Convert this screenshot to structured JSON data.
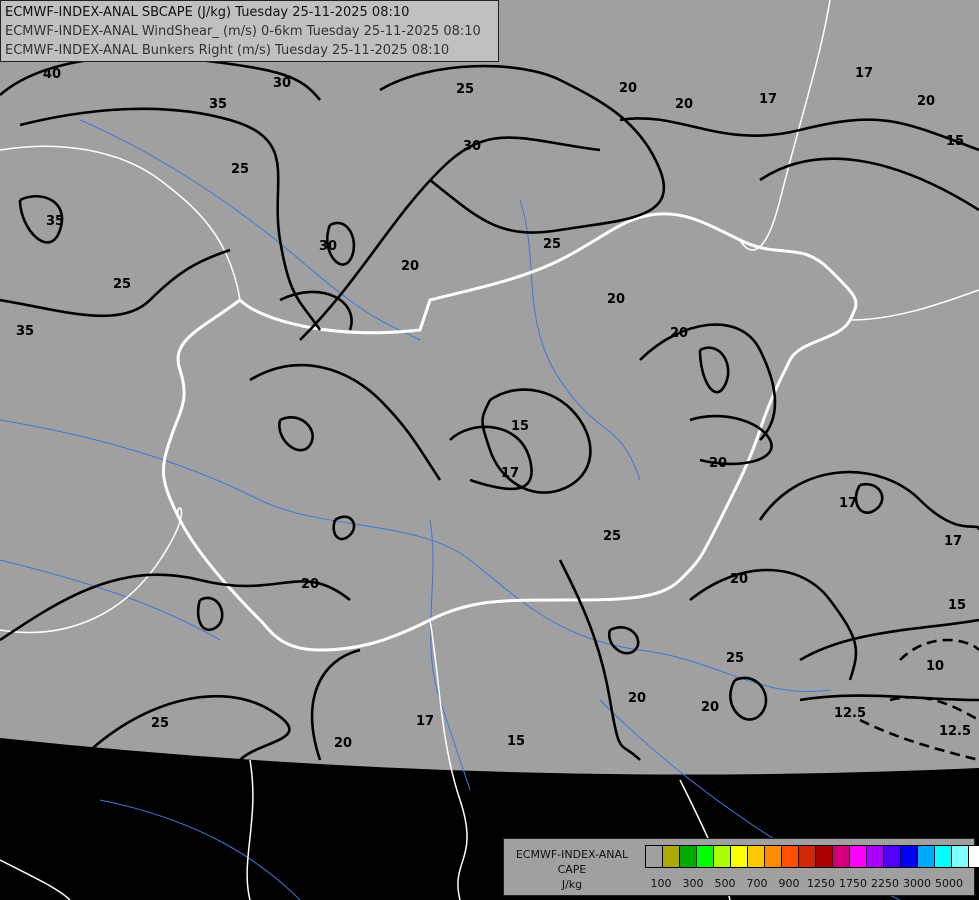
{
  "header": {
    "lines": [
      "ECMWF-INDEX-ANAL SBCAPE (J/kg) Tuesday 25-11-2025 08:10",
      "ECMWF-INDEX-ANAL WindShear_ (m/s) 0-6km Tuesday 25-11-2025 08:10",
      "ECMWF-INDEX-ANAL Bunkers Right (m/s) Tuesday 25-11-2025 08:10"
    ]
  },
  "legend": {
    "model": "ECMWF-INDEX-ANAL",
    "field": "CAPE",
    "unit": "J/kg",
    "colors": [
      "#a0a0a0",
      "#aaaa00",
      "#00aa00",
      "#00ff00",
      "#aaff00",
      "#ffff00",
      "#ffc800",
      "#ff8c00",
      "#ff5000",
      "#d22800",
      "#aa0000",
      "#d2007a",
      "#ff00ff",
      "#aa00ff",
      "#5000ff",
      "#0000ff",
      "#00aaff",
      "#00ffff",
      "#80ffff",
      "#ffffff"
    ],
    "ticks": [
      "100",
      "300",
      "500",
      "700",
      "900",
      "1250",
      "1750",
      "2250",
      "3000",
      "5000"
    ]
  },
  "map": {
    "colors": {
      "land": "#a0a0a0",
      "outside": "#000000",
      "borders": "#ffffff",
      "rivers": "#3c78d8",
      "contours": "#000000"
    },
    "contour_labels": [
      "40",
      "35",
      "30",
      "25",
      "20",
      "20",
      "17",
      "17",
      "20",
      "15",
      "30",
      "25",
      "35",
      "25",
      "30",
      "20",
      "25",
      "20",
      "35",
      "20",
      "15",
      "17",
      "20",
      "17",
      "25",
      "17",
      "20",
      "20",
      "15",
      "10",
      "25",
      "20",
      "20",
      "12.5",
      "12.5",
      "25",
      "17",
      "15",
      "20"
    ]
  }
}
